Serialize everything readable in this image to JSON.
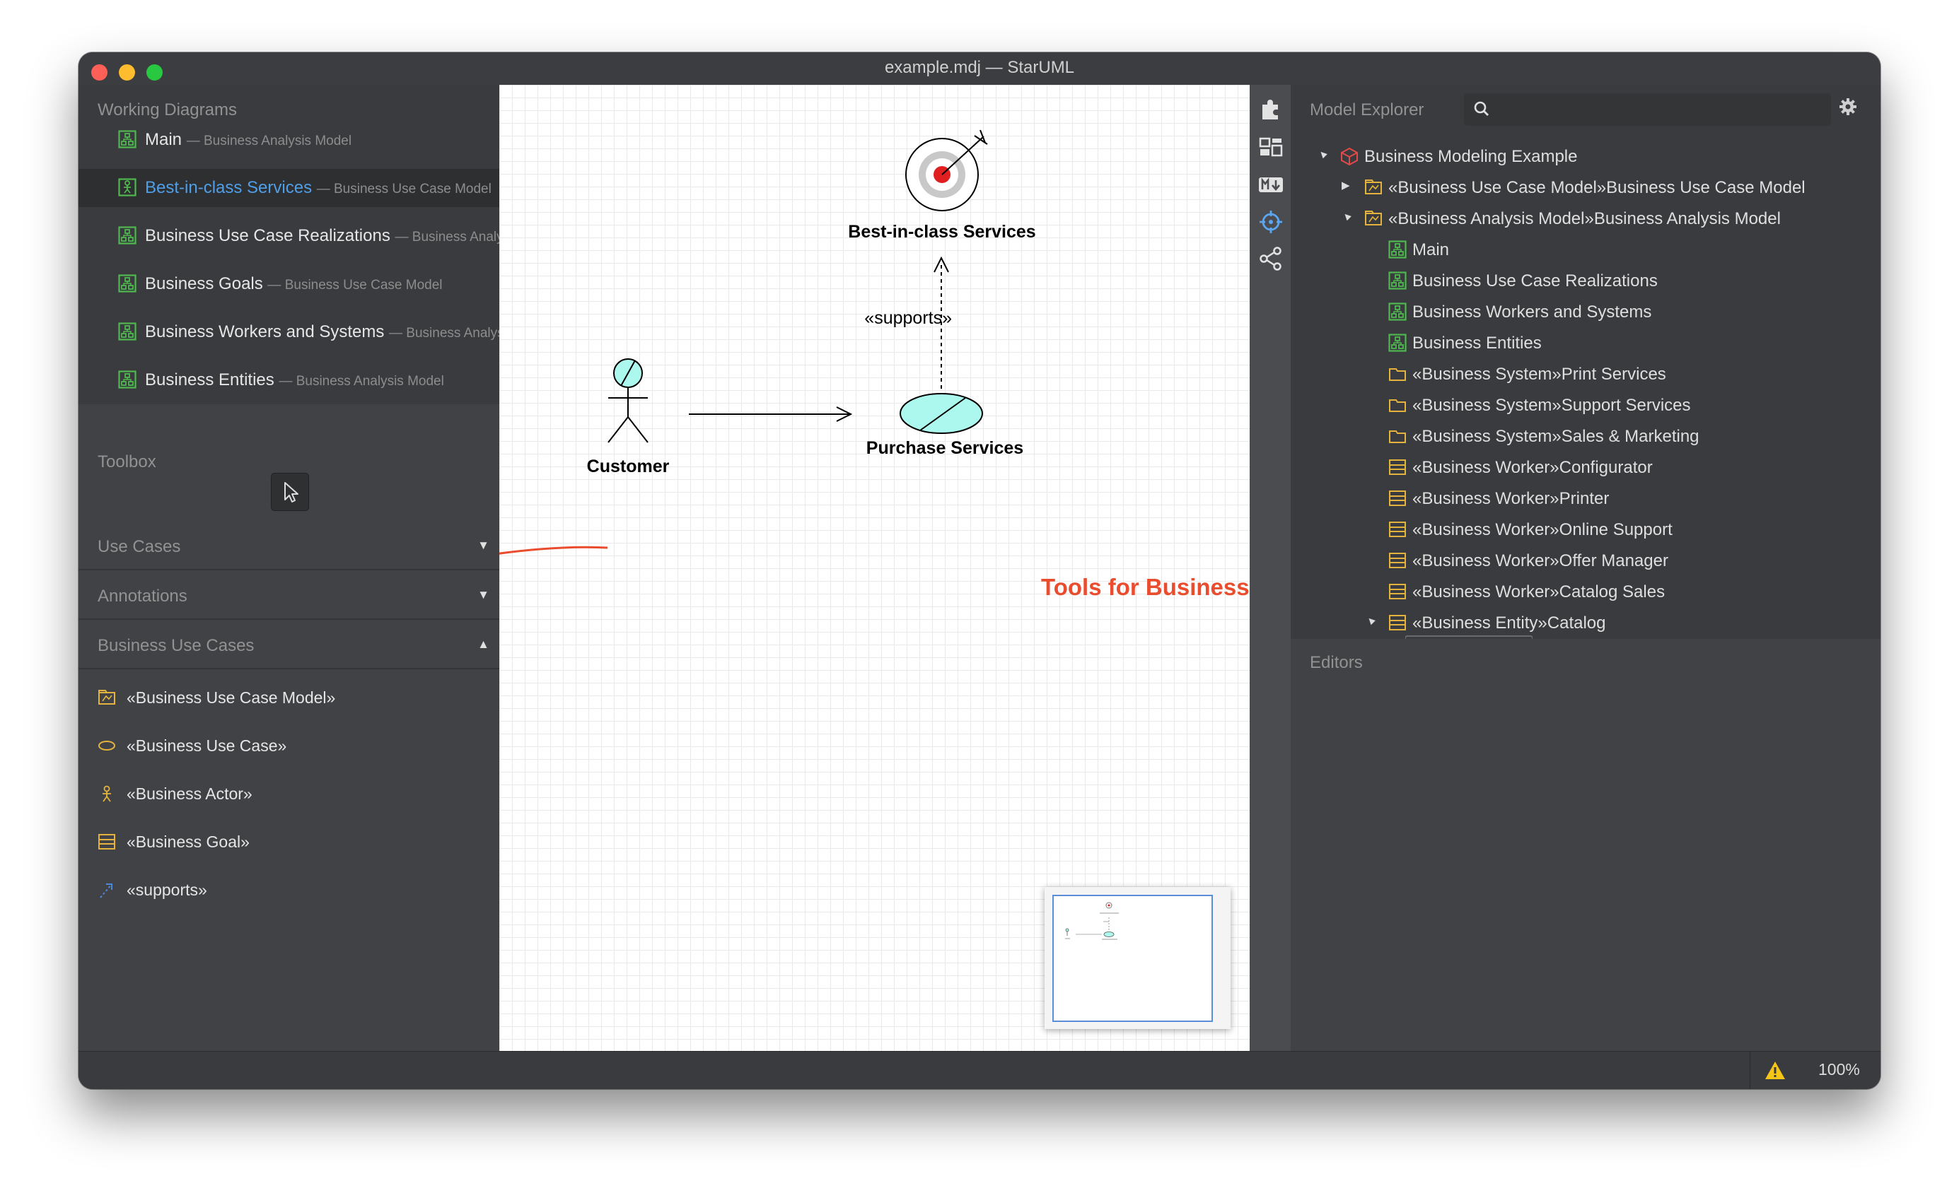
{
  "window": {
    "title": "example.mdj — StarUML"
  },
  "working_diagrams": {
    "title": "Working Diagrams",
    "items": [
      {
        "name": "Main",
        "owner": "— Business Analysis Model",
        "active": false
      },
      {
        "name": "Best-in-class Services",
        "owner": "— Business Use Case Model",
        "active": true
      },
      {
        "name": "Business Use Case Realizations",
        "owner": "— Business Analysis Model",
        "active": false
      },
      {
        "name": "Business Goals",
        "owner": "— Business Use Case Model",
        "active": false
      },
      {
        "name": "Business Workers and Systems",
        "owner": "— Business Analysis Model",
        "active": false
      },
      {
        "name": "Business Entities",
        "owner": "— Business Analysis Model",
        "active": false
      }
    ]
  },
  "toolbox": {
    "title": "Toolbox",
    "categories": [
      {
        "label": "Use Cases",
        "arrow": "▼"
      },
      {
        "label": "Annotations",
        "arrow": "▼"
      },
      {
        "label": "Business Use Cases",
        "arrow": "▲"
      }
    ],
    "tools": [
      {
        "label": "«Business Use Case Model»",
        "icon": "business-use-case-model-icon"
      },
      {
        "label": "«Business Use Case»",
        "icon": "business-use-case-icon"
      },
      {
        "label": "«Business Actor»",
        "icon": "business-actor-icon"
      },
      {
        "label": "«Business Goal»",
        "icon": "business-goal-icon"
      },
      {
        "label": "«supports»",
        "icon": "supports-icon"
      }
    ]
  },
  "diagram": {
    "goal_label": "Best-in-class Services",
    "supports_label": "«supports»",
    "actor_label": "Customer",
    "usecase_label": "Purchase Services",
    "colors": {
      "fill": "#adf8ee",
      "target_red": "#e02020",
      "annotation_red": "#ea4c2e"
    }
  },
  "annotation": {
    "text": "Tools for Business Use Cases"
  },
  "model_explorer": {
    "title": "Model Explorer",
    "search_placeholder": "",
    "tree": [
      {
        "label": "Business Modeling Example",
        "icon": "project-icon",
        "twisty": "▲",
        "depth": 0
      },
      {
        "label": "«Business Use Case Model»Business Use Case Model",
        "icon": "model-icon",
        "twisty": "▶",
        "depth": 1
      },
      {
        "label": "«Business Analysis Model»Business Analysis Model",
        "icon": "model-icon",
        "twisty": "▲",
        "depth": 1
      },
      {
        "label": "Main",
        "icon": "diagram-icon",
        "twisty": "",
        "depth": 2
      },
      {
        "label": "Business Use Case Realizations",
        "icon": "diagram-icon",
        "twisty": "",
        "depth": 2
      },
      {
        "label": "Business Workers and Systems",
        "icon": "diagram-icon",
        "twisty": "",
        "depth": 2
      },
      {
        "label": "Business Entities",
        "icon": "diagram-icon",
        "twisty": "",
        "depth": 2
      },
      {
        "label": "«Business System»Print Services",
        "icon": "folder-icon",
        "twisty": "",
        "depth": 2
      },
      {
        "label": "«Business System»Support Services",
        "icon": "folder-icon",
        "twisty": "",
        "depth": 2
      },
      {
        "label": "«Business System»Sales & Marketing",
        "icon": "folder-icon",
        "twisty": "",
        "depth": 2
      },
      {
        "label": "«Business Worker»Configurator",
        "icon": "class-icon",
        "twisty": "",
        "depth": 2
      },
      {
        "label": "«Business Worker»Printer",
        "icon": "class-icon",
        "twisty": "",
        "depth": 2
      },
      {
        "label": "«Business Worker»Online Support",
        "icon": "class-icon",
        "twisty": "",
        "depth": 2
      },
      {
        "label": "«Business Worker»Offer Manager",
        "icon": "class-icon",
        "twisty": "",
        "depth": 2
      },
      {
        "label": "«Business Worker»Catalog Sales",
        "icon": "class-icon",
        "twisty": "",
        "depth": 2
      },
      {
        "label": "«Business Entity»Catalog",
        "icon": "class-icon",
        "twisty": "▲",
        "depth": 2
      }
    ]
  },
  "editors": {
    "title": "Editors"
  },
  "statusbar": {
    "zoom": "100%"
  }
}
